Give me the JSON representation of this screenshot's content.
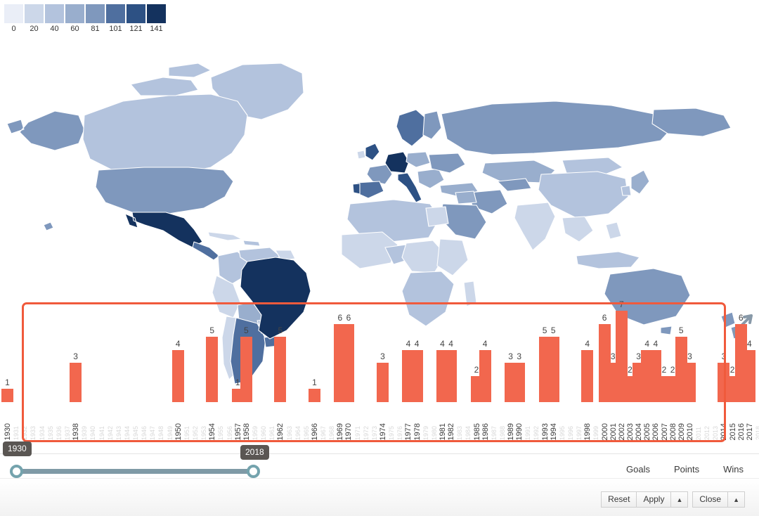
{
  "legend": {
    "name": "choropleth-color-scale",
    "stops": [
      {
        "label": "0",
        "color": "#eaeef7"
      },
      {
        "label": "20",
        "color": "#ccd7e9"
      },
      {
        "label": "40",
        "color": "#b3c3dd"
      },
      {
        "label": "60",
        "color": "#99aecd"
      },
      {
        "label": "81",
        "color": "#7f98bd"
      },
      {
        "label": "101",
        "color": "#4f6f9f"
      },
      {
        "label": "121",
        "color": "#2d5184"
      },
      {
        "label": "141",
        "color": "#14325e"
      }
    ]
  },
  "chart_data": {
    "type": "bar",
    "title": "",
    "xlabel": "",
    "ylabel": "",
    "ylim": [
      0,
      7
    ],
    "grid": false,
    "legend_position": "none",
    "bar_color": "#f2674e",
    "categories": [
      "1930",
      "1938",
      "1950",
      "1954",
      "1957",
      "1958",
      "1962",
      "1966",
      "1969",
      "1970",
      "1974",
      "1977",
      "1978",
      "1981",
      "1982",
      "1985",
      "1986",
      "1989",
      "1990",
      "1993",
      "1994",
      "1998",
      "2000",
      "2001",
      "2002",
      "2003",
      "2004",
      "2005",
      "2006",
      "2007",
      "2008",
      "2009",
      "2010",
      "2014",
      "2015",
      "2016",
      "2017"
    ],
    "values": [
      1,
      3,
      4,
      5,
      1,
      5,
      5,
      1,
      6,
      6,
      3,
      4,
      4,
      4,
      4,
      2,
      4,
      3,
      3,
      5,
      5,
      4,
      6,
      3,
      7,
      2,
      3,
      4,
      4,
      2,
      2,
      5,
      3,
      3,
      2,
      6,
      4
    ],
    "faded_tick_years": [
      "1931",
      "1932",
      "1933",
      "1934",
      "1935",
      "1936",
      "1937",
      "1939",
      "1940",
      "1941",
      "1942",
      "1943",
      "1944",
      "1945",
      "1946",
      "1947",
      "1948",
      "1949",
      "1951",
      "1952",
      "1953",
      "1955",
      "1956",
      "1959",
      "1960",
      "1961",
      "1963",
      "1964",
      "1965",
      "1967",
      "1968",
      "1971",
      "1972",
      "1973",
      "1975",
      "1976",
      "1979",
      "1980",
      "1983",
      "1984",
      "1987",
      "1988",
      "1991",
      "1992",
      "1995",
      "1996",
      "1997",
      "1999",
      "2011",
      "2012",
      "2013",
      "2018"
    ],
    "selection": {
      "start": "1930",
      "end": "2018",
      "highlight_color": "#f05a3c"
    }
  },
  "slider": {
    "name": "year-range-slider",
    "min_label": "1930",
    "max_label": "2018",
    "track_color": "#7f9aa6",
    "handle_color": "#74a3ad"
  },
  "metrics": {
    "items": [
      {
        "label": "Goals"
      },
      {
        "label": "Points"
      },
      {
        "label": "Wins"
      }
    ]
  },
  "buttons": {
    "reset": "Reset",
    "apply": "Apply",
    "apply_caret": "▲",
    "close": "Close",
    "close_caret": "▲"
  }
}
